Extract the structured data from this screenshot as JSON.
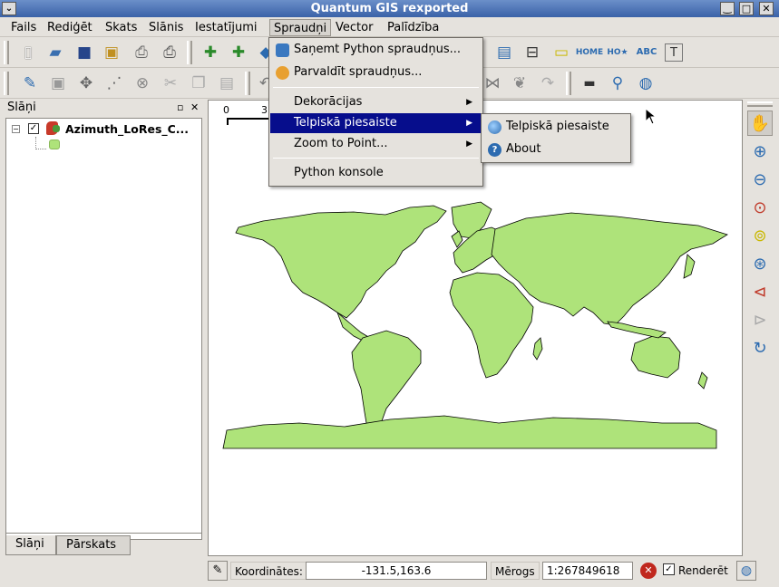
{
  "window": {
    "title": "Quantum GIS rexported",
    "menu_button": "⌄",
    "minimize": "‿",
    "maximize": "□",
    "close": "✕"
  },
  "menubar": [
    {
      "label": "Fails"
    },
    {
      "label": "Rediģēt"
    },
    {
      "label": "Skats"
    },
    {
      "label": "Slānis"
    },
    {
      "label": "Iestatījumi"
    },
    {
      "label": "Spraudņi"
    },
    {
      "label": "Vector"
    },
    {
      "label": "Palīdzība"
    }
  ],
  "toolbar1": [
    {
      "icon": "new-project-icon"
    },
    {
      "icon": "open-project-icon"
    },
    {
      "icon": "save-project-icon"
    },
    {
      "icon": "save-as-icon"
    },
    {
      "icon": "print-composer-icon"
    },
    {
      "icon": "print-icon"
    },
    {
      "icon": "add-vector-layer-icon"
    },
    {
      "icon": "add-raster-layer-icon"
    },
    {
      "icon": "add-postgis-layer-icon"
    },
    {
      "icon": "attribute-table-icon"
    },
    {
      "icon": "measure-icon"
    },
    {
      "icon": "map-tips-icon"
    },
    {
      "icon": "home-icon"
    },
    {
      "icon": "new-bookmark-icon"
    },
    {
      "icon": "spell-check-icon"
    },
    {
      "icon": "text-annotation-icon"
    }
  ],
  "toolbar2": [
    {
      "icon": "edit-pencil-icon"
    },
    {
      "icon": "save-edits-icon"
    },
    {
      "icon": "move-feature-icon"
    },
    {
      "icon": "node-tool-icon"
    },
    {
      "icon": "delete-feature-icon"
    },
    {
      "icon": "cut-icon"
    },
    {
      "icon": "copy-icon"
    },
    {
      "icon": "paste-icon"
    },
    {
      "icon": "undo-icon"
    },
    {
      "icon": "network-icon"
    },
    {
      "icon": "brain-icon"
    },
    {
      "icon": "redo-icon"
    },
    {
      "icon": "scale-bar-icon"
    },
    {
      "icon": "identify-icon"
    },
    {
      "icon": "globe-icon"
    }
  ],
  "layers_panel": {
    "title": "Slāņi",
    "float_icon": "▫",
    "close_icon": "✕",
    "layer_name": "Azimuth_LoRes_C...",
    "checked": true,
    "tabs": [
      "Slāņi",
      "Pārskats"
    ]
  },
  "canvas": {
    "scale_label_0": "0",
    "scale_label_1": "3"
  },
  "plugins_menu": {
    "items": [
      {
        "label": "Saņemt Python spraudņus...",
        "icon": "python-icon"
      },
      {
        "label": "Parvaldīt spraudņus...",
        "icon": "manage-plugins-icon"
      },
      {
        "label": "Dekorācijas",
        "submenu": true
      },
      {
        "label": "Telpiskā piesaiste",
        "submenu": true,
        "highlighted": true
      },
      {
        "label": "Zoom to Point...",
        "submenu": true
      },
      {
        "label": "Python konsole"
      }
    ]
  },
  "submenu": {
    "items": [
      {
        "label": "Telpiskā piesaiste",
        "icon": "georeferencer-icon"
      },
      {
        "label": "About",
        "icon": "about-icon"
      }
    ]
  },
  "right_toolbar": [
    {
      "icon": "pan-hand-icon"
    },
    {
      "icon": "zoom-in-icon"
    },
    {
      "icon": "zoom-out-icon"
    },
    {
      "icon": "zoom-full-icon"
    },
    {
      "icon": "zoom-selection-icon"
    },
    {
      "icon": "zoom-layer-icon"
    },
    {
      "icon": "zoom-last-icon"
    },
    {
      "icon": "zoom-next-icon"
    },
    {
      "icon": "refresh-icon"
    }
  ],
  "statusbar": {
    "coord_label": "Koordinātes:",
    "coord_value": "-131.5,163.6",
    "scale_label": "Mērogs",
    "scale_value": "1:267849618",
    "render_label": "Renderēt",
    "render_checked": true
  },
  "colors": {
    "land": "#aee37a",
    "highlight": "#060d8c",
    "title_bar": "#3a62a8"
  }
}
